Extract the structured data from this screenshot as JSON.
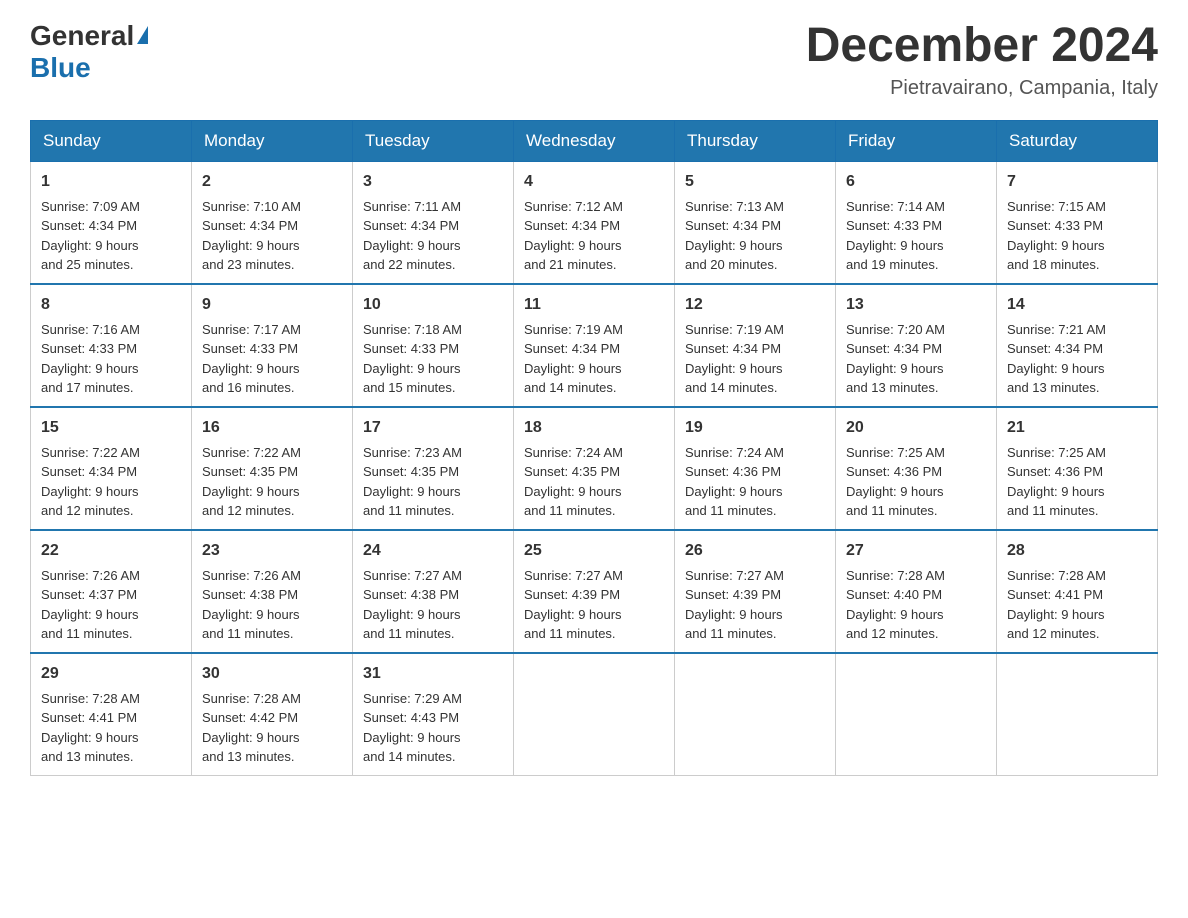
{
  "header": {
    "logo_general": "General",
    "logo_blue": "Blue",
    "month_title": "December 2024",
    "location": "Pietravairano, Campania, Italy"
  },
  "days_of_week": [
    "Sunday",
    "Monday",
    "Tuesday",
    "Wednesday",
    "Thursday",
    "Friday",
    "Saturday"
  ],
  "weeks": [
    [
      {
        "day": "1",
        "sunrise": "7:09 AM",
        "sunset": "4:34 PM",
        "daylight": "9 hours and 25 minutes."
      },
      {
        "day": "2",
        "sunrise": "7:10 AM",
        "sunset": "4:34 PM",
        "daylight": "9 hours and 23 minutes."
      },
      {
        "day": "3",
        "sunrise": "7:11 AM",
        "sunset": "4:34 PM",
        "daylight": "9 hours and 22 minutes."
      },
      {
        "day": "4",
        "sunrise": "7:12 AM",
        "sunset": "4:34 PM",
        "daylight": "9 hours and 21 minutes."
      },
      {
        "day": "5",
        "sunrise": "7:13 AM",
        "sunset": "4:34 PM",
        "daylight": "9 hours and 20 minutes."
      },
      {
        "day": "6",
        "sunrise": "7:14 AM",
        "sunset": "4:33 PM",
        "daylight": "9 hours and 19 minutes."
      },
      {
        "day": "7",
        "sunrise": "7:15 AM",
        "sunset": "4:33 PM",
        "daylight": "9 hours and 18 minutes."
      }
    ],
    [
      {
        "day": "8",
        "sunrise": "7:16 AM",
        "sunset": "4:33 PM",
        "daylight": "9 hours and 17 minutes."
      },
      {
        "day": "9",
        "sunrise": "7:17 AM",
        "sunset": "4:33 PM",
        "daylight": "9 hours and 16 minutes."
      },
      {
        "day": "10",
        "sunrise": "7:18 AM",
        "sunset": "4:33 PM",
        "daylight": "9 hours and 15 minutes."
      },
      {
        "day": "11",
        "sunrise": "7:19 AM",
        "sunset": "4:34 PM",
        "daylight": "9 hours and 14 minutes."
      },
      {
        "day": "12",
        "sunrise": "7:19 AM",
        "sunset": "4:34 PM",
        "daylight": "9 hours and 14 minutes."
      },
      {
        "day": "13",
        "sunrise": "7:20 AM",
        "sunset": "4:34 PM",
        "daylight": "9 hours and 13 minutes."
      },
      {
        "day": "14",
        "sunrise": "7:21 AM",
        "sunset": "4:34 PM",
        "daylight": "9 hours and 13 minutes."
      }
    ],
    [
      {
        "day": "15",
        "sunrise": "7:22 AM",
        "sunset": "4:34 PM",
        "daylight": "9 hours and 12 minutes."
      },
      {
        "day": "16",
        "sunrise": "7:22 AM",
        "sunset": "4:35 PM",
        "daylight": "9 hours and 12 minutes."
      },
      {
        "day": "17",
        "sunrise": "7:23 AM",
        "sunset": "4:35 PM",
        "daylight": "9 hours and 11 minutes."
      },
      {
        "day": "18",
        "sunrise": "7:24 AM",
        "sunset": "4:35 PM",
        "daylight": "9 hours and 11 minutes."
      },
      {
        "day": "19",
        "sunrise": "7:24 AM",
        "sunset": "4:36 PM",
        "daylight": "9 hours and 11 minutes."
      },
      {
        "day": "20",
        "sunrise": "7:25 AM",
        "sunset": "4:36 PM",
        "daylight": "9 hours and 11 minutes."
      },
      {
        "day": "21",
        "sunrise": "7:25 AM",
        "sunset": "4:36 PM",
        "daylight": "9 hours and 11 minutes."
      }
    ],
    [
      {
        "day": "22",
        "sunrise": "7:26 AM",
        "sunset": "4:37 PM",
        "daylight": "9 hours and 11 minutes."
      },
      {
        "day": "23",
        "sunrise": "7:26 AM",
        "sunset": "4:38 PM",
        "daylight": "9 hours and 11 minutes."
      },
      {
        "day": "24",
        "sunrise": "7:27 AM",
        "sunset": "4:38 PM",
        "daylight": "9 hours and 11 minutes."
      },
      {
        "day": "25",
        "sunrise": "7:27 AM",
        "sunset": "4:39 PM",
        "daylight": "9 hours and 11 minutes."
      },
      {
        "day": "26",
        "sunrise": "7:27 AM",
        "sunset": "4:39 PM",
        "daylight": "9 hours and 11 minutes."
      },
      {
        "day": "27",
        "sunrise": "7:28 AM",
        "sunset": "4:40 PM",
        "daylight": "9 hours and 12 minutes."
      },
      {
        "day": "28",
        "sunrise": "7:28 AM",
        "sunset": "4:41 PM",
        "daylight": "9 hours and 12 minutes."
      }
    ],
    [
      {
        "day": "29",
        "sunrise": "7:28 AM",
        "sunset": "4:41 PM",
        "daylight": "9 hours and 13 minutes."
      },
      {
        "day": "30",
        "sunrise": "7:28 AM",
        "sunset": "4:42 PM",
        "daylight": "9 hours and 13 minutes."
      },
      {
        "day": "31",
        "sunrise": "7:29 AM",
        "sunset": "4:43 PM",
        "daylight": "9 hours and 14 minutes."
      },
      null,
      null,
      null,
      null
    ]
  ],
  "labels": {
    "sunrise": "Sunrise:",
    "sunset": "Sunset:",
    "daylight": "Daylight:"
  }
}
